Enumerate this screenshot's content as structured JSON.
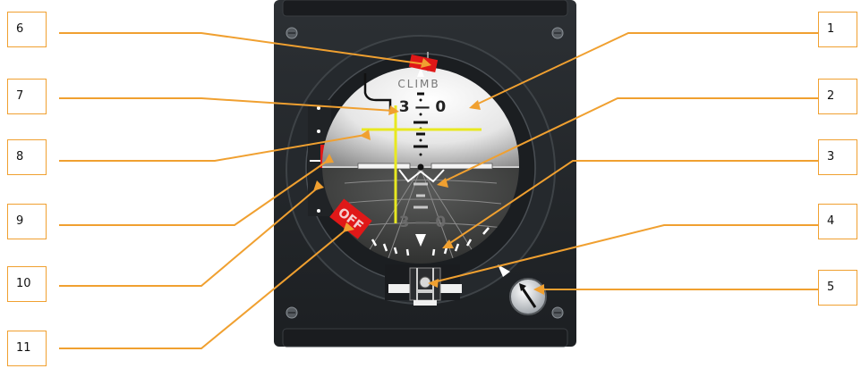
{
  "callouts_left": [
    "6",
    "7",
    "8",
    "9",
    "10",
    "11"
  ],
  "callouts_right": [
    "1",
    "2",
    "3",
    "4",
    "5"
  ],
  "instrument": {
    "pitch_scale_top": "3 — 0",
    "pitch_scale_bottom": "3 — 0",
    "climb_label": "CLIMB",
    "off_flag": "OFF"
  },
  "colors": {
    "leader": "#f0a030",
    "bezel": "#23272b",
    "sphere_light": "#ffffff",
    "sphere_dark": "#3c3d3c",
    "steering_bars": "#e8e820",
    "flag": "#e01818"
  }
}
